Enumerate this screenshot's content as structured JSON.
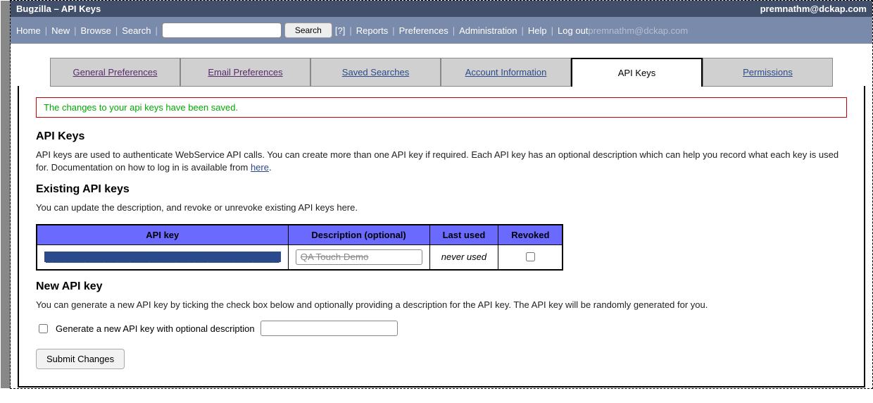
{
  "banner": {
    "title": "Bugzilla – API Keys",
    "user": "premnathm@dckap.com"
  },
  "nav": {
    "home": "Home",
    "new": "New",
    "browse": "Browse",
    "search": "Search",
    "search_btn": "Search",
    "help_q": "[?]",
    "reports": "Reports",
    "preferences": "Preferences",
    "administration": "Administration",
    "help": "Help",
    "logout_prefix": "Log out",
    "logout_user": "premnathm@dckap.com"
  },
  "tabs": {
    "general": "General Preferences",
    "email": "Email Preferences",
    "saved": "Saved Searches",
    "account": "Account Information",
    "apikeys": "API Keys",
    "permissions": "Permissions"
  },
  "message": "The changes to your api keys have been saved.",
  "section1": {
    "heading": "API Keys",
    "desc_a": "API keys are used to authenticate WebService API calls. You can create more than one API key if required. Each API key has an optional description which can help you record what each key is used for. Documentation on how to log in is available from ",
    "desc_link": "here",
    "desc_b": "."
  },
  "existing": {
    "heading": "Existing API keys",
    "desc": "You can update the description, and revoke or unrevoke existing API keys here.",
    "cols": {
      "key": "API key",
      "desc": "Description (optional)",
      "last": "Last used",
      "revoked": "Revoked"
    },
    "row": {
      "key_text": "████████████████████████████████████",
      "desc_value": "QA Touch Demo",
      "last_used": "never used",
      "revoked": false
    }
  },
  "newkey": {
    "heading": "New API key",
    "desc": "You can generate a new API key by ticking the check box below and optionally providing a description for the API key. The API key will be randomly generated for you.",
    "checkbox_label": "Generate a new API key with optional description"
  },
  "submit": "Submit Changes"
}
